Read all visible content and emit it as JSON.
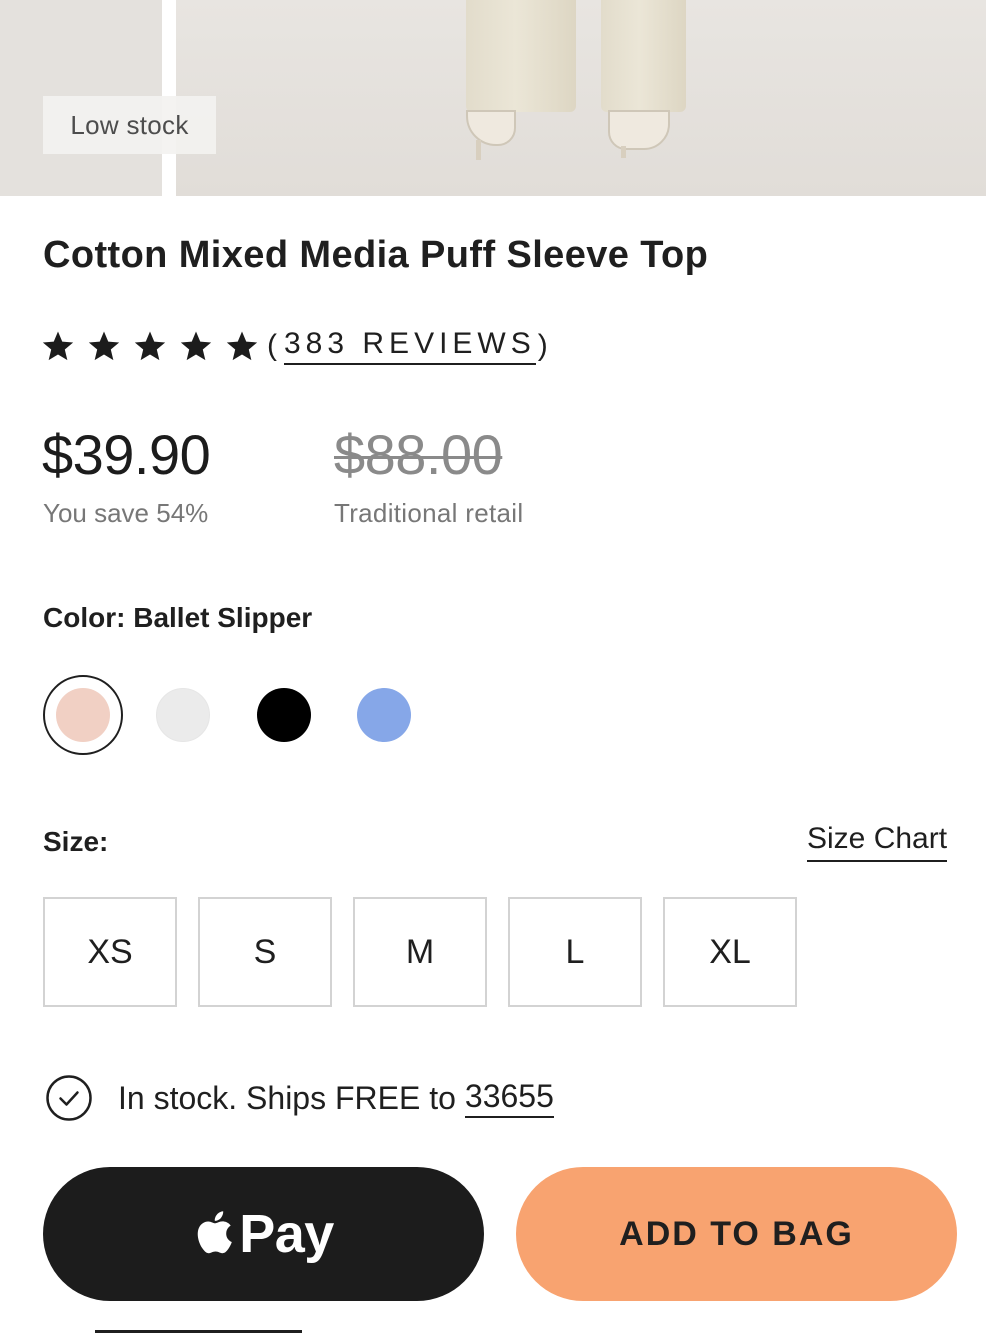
{
  "hero": {
    "badge": "Low stock"
  },
  "product": {
    "title": "Cotton Mixed Media Puff Sleeve Top",
    "rating": {
      "stars": 5,
      "reviews_open": "(",
      "reviews_count": "383 REVIEWS",
      "reviews_close": ")"
    },
    "price": "$39.90",
    "savings": "You save 54%",
    "original_price": "$88.00",
    "original_label": "Traditional retail"
  },
  "color": {
    "label": "Color:",
    "selected": "Ballet Slipper",
    "swatches": [
      {
        "color": "#f1d0c4",
        "selected": true
      },
      {
        "color": "#ebebeb",
        "selected": false
      },
      {
        "color": "#000000",
        "selected": false
      },
      {
        "color": "#86a7e8",
        "selected": false
      }
    ]
  },
  "size": {
    "label": "Size:",
    "chart_link": "Size Chart",
    "options": [
      "XS",
      "S",
      "M",
      "L",
      "XL"
    ]
  },
  "shipping": {
    "text": "In stock. Ships FREE to",
    "zip": "33655"
  },
  "actions": {
    "apple_pay": "Pay",
    "add_to_bag": "ADD TO BAG"
  },
  "icons": {
    "star": "star-icon",
    "check": "check-circle-icon",
    "apple": "apple-logo-icon"
  },
  "colors": {
    "accent": "#f8a370",
    "text": "#1f1f1f",
    "muted": "#777777",
    "apple_pay_bg": "#1c1c1c"
  }
}
